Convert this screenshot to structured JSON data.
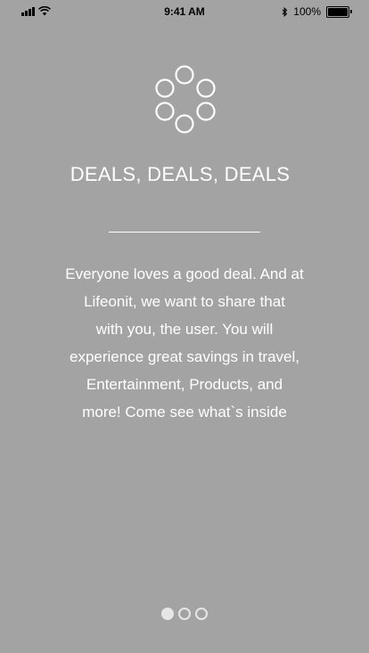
{
  "status_bar": {
    "time": "9:41 AM",
    "battery_text": "100%",
    "icons": [
      "signal-icon",
      "wifi-icon",
      "bluetooth-icon",
      "battery-icon"
    ]
  },
  "onboarding": {
    "icon": "circle-ring-icon",
    "title": "DEALS, DEALS, DEALS",
    "description_lines": [
      "Everyone loves a good deal. And at",
      "Lifeonit, we want to share that",
      "with you, the user. You will",
      "experience great savings in travel,",
      "Entertainment, Products, and",
      "more! Come see what`s inside"
    ]
  },
  "pager": {
    "count": 3,
    "active_index": 0
  },
  "colors": {
    "background": "#a3a3a3",
    "text": "#ffffff",
    "dot": "#e6e6e6"
  }
}
